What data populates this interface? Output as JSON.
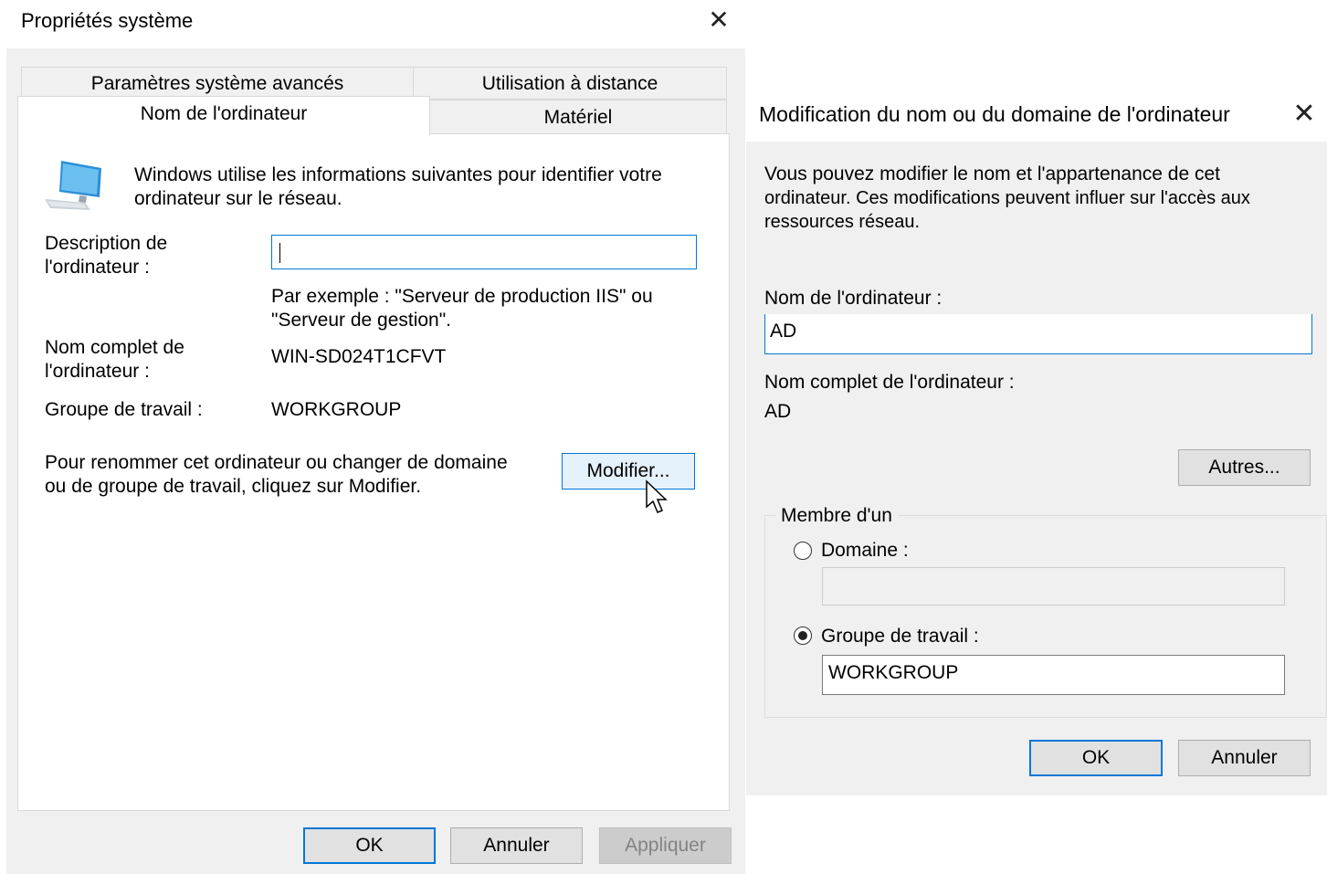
{
  "system_properties": {
    "title": "Propriétés système",
    "close_glyph": "✕",
    "tabs": {
      "advanced": "Paramètres système avancés",
      "remote": "Utilisation à distance",
      "computer_name": "Nom de l'ordinateur",
      "hardware": "Matériel"
    },
    "intro_line1": "Windows utilise les informations suivantes pour identifier votre",
    "intro_line2": "ordinateur sur le réseau.",
    "description_label_line1": "Description de",
    "description_label_line2": "l'ordinateur :",
    "description_value": "",
    "example_line1": "Par exemple : \"Serveur de production IIS\" ou",
    "example_line2": "\"Serveur de gestion\".",
    "full_name_label_line1": "Nom complet de",
    "full_name_label_line2": "l'ordinateur :",
    "full_name_value": "WIN-SD024T1CFVT",
    "workgroup_label": "Groupe de travail :",
    "workgroup_value": "WORKGROUP",
    "rename_text_line1": "Pour renommer cet ordinateur ou changer de domaine",
    "rename_text_line2": "ou de groupe de travail, cliquez sur Modifier.",
    "modify_button": "Modifier...",
    "ok_button": "OK",
    "cancel_button": "Annuler",
    "apply_button": "Appliquer"
  },
  "rename_dialog": {
    "title": "Modification du nom ou du domaine de l'ordinateur",
    "close_glyph": "✕",
    "info_line1": "Vous pouvez modifier le nom et l'appartenance de cet",
    "info_line2": "ordinateur. Ces modifications peuvent influer sur l'accès aux",
    "info_line3": "ressources réseau.",
    "computer_name_label": "Nom de l'ordinateur :",
    "computer_name_value": "AD",
    "full_name_label": "Nom complet de l'ordinateur :",
    "full_name_value": "AD",
    "more_button": "Autres...",
    "member_of_label": "Membre d'un",
    "domain_label": "Domaine :",
    "domain_value": "",
    "workgroup_label": "Groupe de travail :",
    "workgroup_value": "WORKGROUP",
    "selected_membership": "workgroup",
    "ok_button": "OK",
    "cancel_button": "Annuler"
  },
  "colors": {
    "accent": "#0078d7",
    "dialog_background": "#f0f0f0",
    "button_face": "#e1e1e1"
  }
}
